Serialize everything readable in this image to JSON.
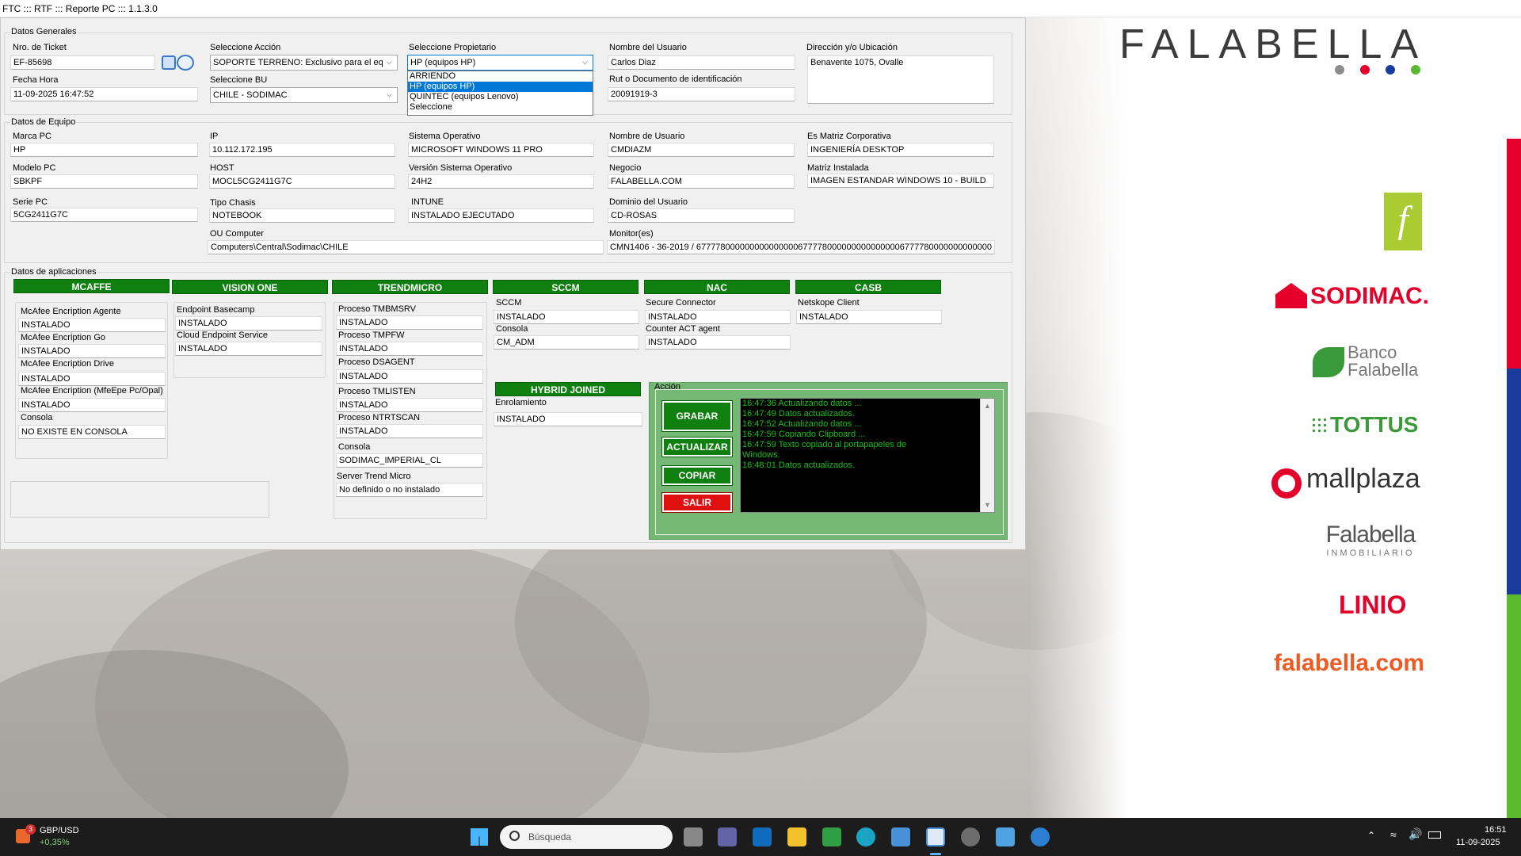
{
  "window": {
    "title": "FTC ::: RTF ::: Reporte PC ::: 1.1.3.0"
  },
  "generales": {
    "legend": "Datos Generales",
    "ticket_label": "Nro. de Ticket",
    "ticket_value": "EF-85698",
    "fecha_label": "Fecha Hora",
    "fecha_value": "11-09-2025 16:47:52",
    "accion_label": "Seleccione Acción",
    "accion_value": "SOPORTE TERRENO: Exclusivo para el eq",
    "bu_label": "Seleccione BU",
    "bu_value": "CHILE - SODIMAC",
    "propietario_label": "Seleccione Propietario",
    "propietario_value": "HP (equipos HP)",
    "propietario_options": [
      "ARRIENDO",
      "HP (equipos HP)",
      "QUINTEC (equipos Lenovo)",
      " Seleccione"
    ],
    "usuario_label": "Nombre del Usuario",
    "usuario_value": "Carlos Diaz",
    "rut_label": "Rut o Documento de identificación",
    "rut_value": "20091919-3",
    "direccion_label": "Dirección y/o Ubicación",
    "direccion_value": "Benavente 1075, Ovalle"
  },
  "equipo": {
    "legend": "Datos de Equipo",
    "marca_label": "Marca PC",
    "marca_value": "HP",
    "modelo_label": "Modelo PC",
    "modelo_value": "SBKPF",
    "serie_label": "Serie PC",
    "serie_value": "5CG2411G7C",
    "ip_label": "IP",
    "ip_value": "10.112.172.195",
    "host_label": "HOST",
    "host_value": "MOCL5CG2411G7C",
    "chasis_label": "Tipo Chasis",
    "chasis_value": "NOTEBOOK",
    "ou_label": "OU Computer",
    "ou_value": "Computers\\Central\\Sodimac\\CHILE",
    "so_label": "Sistema Operativo",
    "so_value": "MICROSOFT WINDOWS 11 PRO",
    "version_label": "Versión Sistema Operativo",
    "version_value": "24H2",
    "intune_label": "INTUNE",
    "intune_value": "INSTALADO EJECUTADO",
    "nomusuario_label": "Nombre de Usuario",
    "nomusuario_value": "CMDIAZM",
    "negocio_label": "Negocio",
    "negocio_value": "FALABELLA.COM",
    "dominio_label": "Dominio del Usuario",
    "dominio_value": "CD-ROSAS",
    "monitores_label": "Monitor(es)",
    "monitores_value": "CMN1406 - 36-2019 / 6777780000000000000006777780000000000000006777780000000000000",
    "matriz_label": "Es Matriz Corporativa",
    "matriz_value": "INGENIERÍA DESKTOP",
    "matrizinst_label": "Matriz Instalada",
    "matrizinst_value": "IMAGEN ESTANDAR WINDOWS 10 - BUILD"
  },
  "aplicaciones": {
    "legend": "Datos de aplicaciones",
    "mcafee": {
      "title": "MCAFFE",
      "items": [
        {
          "label": "McAfee Encription Agente",
          "value": "INSTALADO"
        },
        {
          "label": "McAfee Encription Go",
          "value": "INSTALADO"
        },
        {
          "label": "McAfee Encription Drive",
          "value": "INSTALADO"
        },
        {
          "label": "McAfee Encription (MfeEpe Pc/Opal)",
          "value": "INSTALADO"
        },
        {
          "label": "Consola",
          "value": "NO EXISTE EN CONSOLA"
        }
      ]
    },
    "visionone": {
      "title": "VISION ONE",
      "items": [
        {
          "label": "Endpoint Basecamp",
          "value": "INSTALADO"
        },
        {
          "label": "Cloud Endpoint Service",
          "value": "INSTALADO"
        }
      ]
    },
    "trend": {
      "title": "TRENDMICRO",
      "items": [
        {
          "label": "Proceso TMBMSRV",
          "value": "INSTALADO"
        },
        {
          "label": "Proceso TMPFW",
          "value": "INSTALADO"
        },
        {
          "label": "Proceso DSAGENT",
          "value": "INSTALADO"
        },
        {
          "label": "Proceso TMLISTEN",
          "value": "INSTALADO"
        },
        {
          "label": "Proceso NTRTSCAN",
          "value": "INSTALADO"
        },
        {
          "label": "Consola",
          "value": "SODIMAC_IMPERIAL_CL"
        },
        {
          "label": "Server Trend Micro",
          "value": "No definido o no instalado"
        }
      ]
    },
    "sccm": {
      "title": "SCCM",
      "items": [
        {
          "label": "SCCM",
          "value": "INSTALADO"
        },
        {
          "label": "Consola",
          "value": "CM_ADM"
        }
      ]
    },
    "nac": {
      "title": "NAC",
      "items": [
        {
          "label": "Secure Connector",
          "value": "INSTALADO"
        },
        {
          "label": "Counter ACT agent",
          "value": "INSTALADO"
        }
      ]
    },
    "casb": {
      "title": "CASB",
      "items": [
        {
          "label": "Netskope Client",
          "value": "INSTALADO"
        }
      ]
    },
    "hybrid": {
      "title": "HYBRID JOINED",
      "label": "Enrolamiento",
      "value": "INSTALADO"
    }
  },
  "accion": {
    "legend": "Acción",
    "grabar": "GRABAR",
    "actualizar": "ACTUALIZAR",
    "copiar": "COPIAR",
    "salir": "SALIR",
    "log": [
      "16:47:36 Actualizando datos ...",
      "16:47:49 Datos actualizados.",
      "16:47:52 Actualizando datos ...",
      "16:47:59 Copiando Clipboard ...",
      "16:47:59 Texto copiado al portapapeles de",
      "Windows.",
      "16:48:01 Datos actualizados."
    ]
  },
  "brand": {
    "falabella": "FALABELLA",
    "f_mark": "f",
    "sodimac": "SODIMAC.",
    "banco1": "Banco",
    "banco2": "Falabella",
    "tottus": "TOTTUS",
    "mallplaza": "mallplaza",
    "inmob1": "Falabella",
    "inmob2": "INMOBILIARIO",
    "linio": "LINIO",
    "fcom": "falabella.com",
    "dot_colors": [
      "#8c8c8c",
      "#e4002b",
      "#1a3b9e",
      "#5cb82e"
    ]
  },
  "taskbar": {
    "ticker_name": "GBP/USD",
    "ticker_change": "+0,35%",
    "ticker_badge": "3",
    "search_placeholder": "Búsqueda",
    "time": "16:51",
    "date": "11-09-2025"
  },
  "colors": {
    "accent_green": "#0f800f",
    "exit_red": "#e01010",
    "log_text": "#18c018"
  }
}
